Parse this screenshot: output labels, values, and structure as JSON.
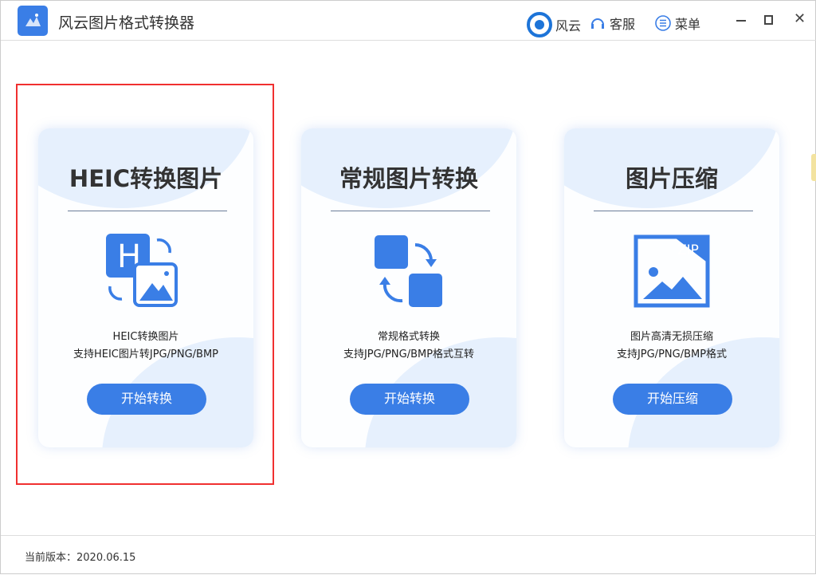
{
  "app": {
    "title": "风云图片格式转换器"
  },
  "toolbar": {
    "brand": "风云",
    "service": "客服",
    "menu": "菜单"
  },
  "cards": [
    {
      "title": "HEIC转换图片",
      "line1": "HEIC转换图片",
      "line2": "支持HEIC图片转JPG/PNG/BMP",
      "button": "开始转换",
      "icon": "heic-convert-icon"
    },
    {
      "title": "常规图片转换",
      "line1": "常规格式转换",
      "line2": "支持JPG/PNG/BMP格式互转",
      "button": "开始转换",
      "icon": "convert-arrows-icon"
    },
    {
      "title": "图片压缩",
      "line1": "图片高清无损压缩",
      "line2": "支持JPG/PNG/BMP格式",
      "button": "开始压缩",
      "icon": "zip-image-icon",
      "zip": "ZIP"
    }
  ],
  "footer": {
    "version": "当前版本：2020.06.15"
  },
  "colors": {
    "accent": "#3a7ee6",
    "highlight": "#f03030"
  }
}
